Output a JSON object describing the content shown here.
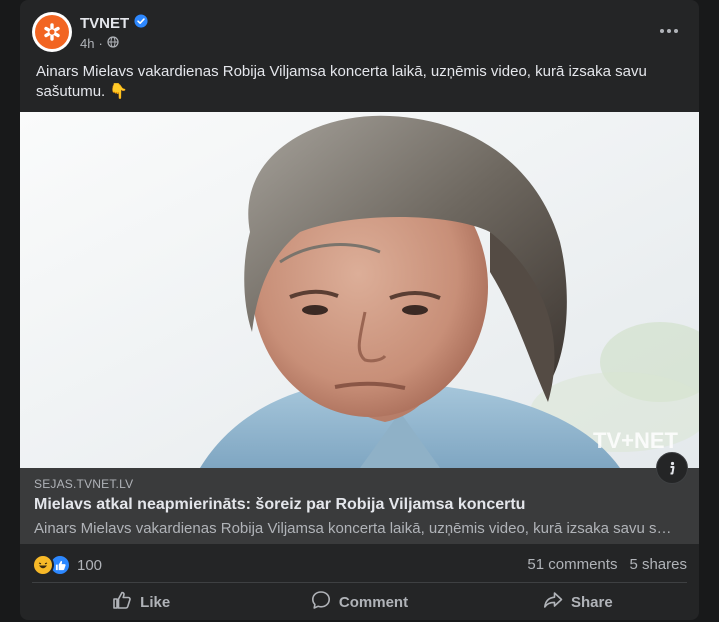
{
  "post": {
    "page_name": "TVNET",
    "time": "4h",
    "caption": "Ainars Mielavs vakardienas Robija Viljamsa koncerta laikā, uzņēmis video, kurā izsaka savu sašutumu. 👇",
    "image_watermark": "TV+NET"
  },
  "link": {
    "domain": "SEJAS.TVNET.LV",
    "title": "Mielavs atkal neapmierināts: šoreiz par Robija Viljamsa koncertu",
    "description": "Ainars Mielavs vakardienas Robija Viljamsa koncerta laikā, uzņēmis video, kurā izsaka savu saš..."
  },
  "stats": {
    "reaction_count": "100",
    "comments": "51 comments",
    "shares": "5 shares"
  },
  "actions": {
    "like": "Like",
    "comment": "Comment",
    "share": "Share"
  },
  "colors": {
    "card_bg": "#242526",
    "page_bg": "#18191a",
    "verified": "#2d88ff",
    "brand_orange": "#f26522"
  },
  "icons": [
    "tvnet-logo-icon",
    "verified-badge-icon",
    "globe-icon",
    "more-options-icon",
    "info-icon",
    "haha-reaction-icon",
    "like-reaction-icon",
    "like-icon",
    "comment-icon",
    "share-icon"
  ]
}
